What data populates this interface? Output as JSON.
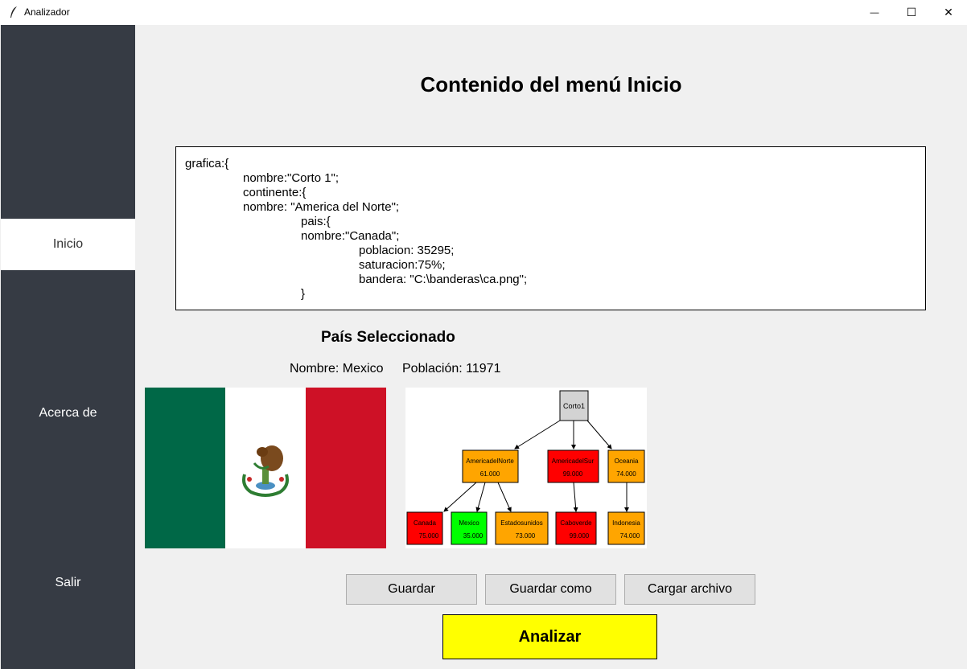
{
  "window": {
    "title": "Analizador",
    "minimize": "—",
    "maximize": "☐",
    "close": "✕"
  },
  "sidebar": {
    "items": [
      {
        "label": "Inicio"
      },
      {
        "label": "Acerca de"
      },
      {
        "label": "Salir"
      }
    ],
    "active": "Inicio"
  },
  "main": {
    "title": "Contenido del menú Inicio",
    "code_lines": [
      "grafica:{",
      "nombre:\"Corto 1\";",
      "continente:{",
      "nombre: \"America del Norte\";",
      "pais:{",
      "nombre:\"Canada\";",
      "poblacion: 35295;",
      "saturacion:75%;",
      "bandera: \"C:\\banderas\\ca.png\";",
      "}"
    ]
  },
  "selected": {
    "title": "País Seleccionado",
    "name": "Nombre: Mexico",
    "population": "Población: 11971",
    "flag_colors": [
      "#006847",
      "#ffffff",
      "#ce1126"
    ]
  },
  "tree": {
    "root": {
      "label": "Corto1",
      "color": "#d3d3d3"
    },
    "continents": [
      {
        "name": "AmericadelNorte",
        "value": "61.000",
        "color": "#ffa500"
      },
      {
        "name": "AmericadelSur",
        "value": "99.000",
        "color": "#ff0000"
      },
      {
        "name": "Oceania",
        "value": "74.000",
        "color": "#ffa500"
      }
    ],
    "countries": [
      {
        "name": "Canada",
        "value": "75.000",
        "color": "#ff0000"
      },
      {
        "name": "Mexico",
        "value": "35.000",
        "color": "#00ff00"
      },
      {
        "name": "Estadosunidos",
        "value": "73.000",
        "color": "#ffa500"
      },
      {
        "name": "Caboverde",
        "value": "99.000",
        "color": "#ff0000"
      },
      {
        "name": "Indonesia",
        "value": "74.000",
        "color": "#ffa500"
      }
    ]
  },
  "buttons": {
    "save": "Guardar",
    "save_as": "Guardar como",
    "load": "Cargar archivo",
    "analyze": "Analizar"
  },
  "colors": {
    "sidebar": "#363b44",
    "analyze_button": "#ffff00"
  }
}
